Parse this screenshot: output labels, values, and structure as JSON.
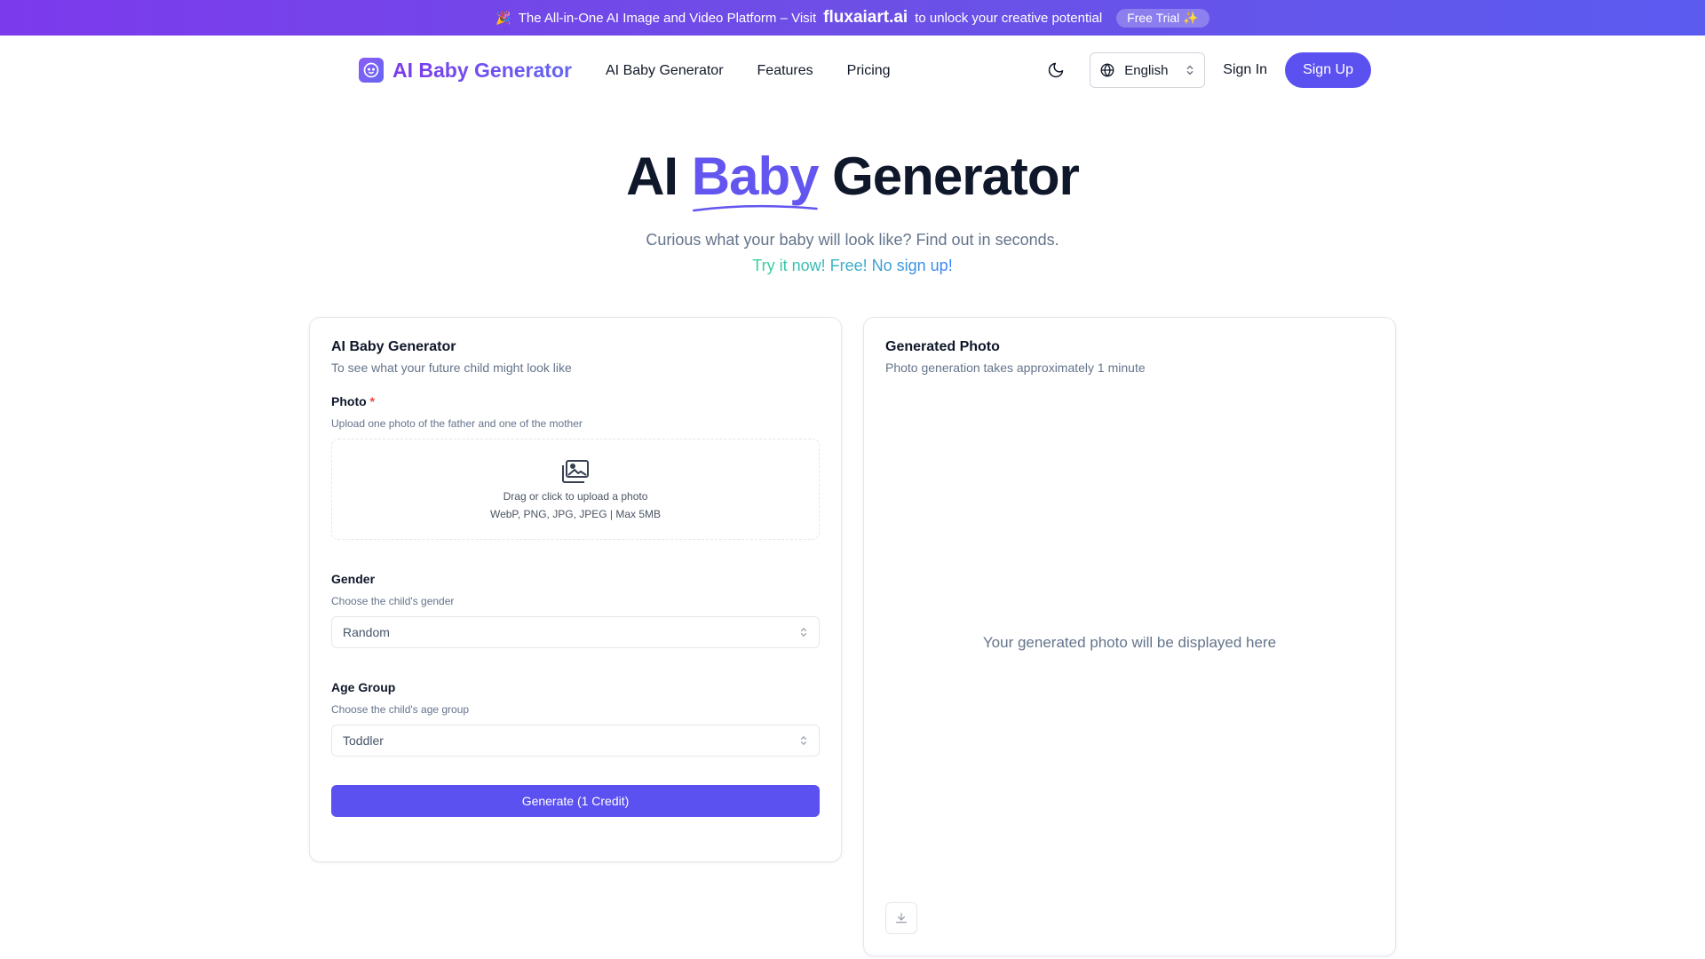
{
  "promo": {
    "text_before": "The All-in-One AI Image and Video Platform – Visit",
    "brand": "fluxaiart.ai",
    "text_after": "to unlock your creative potential",
    "trial_label": "Free Trial"
  },
  "header": {
    "logo_text": "AI Baby Generator",
    "nav": [
      "AI Baby Generator",
      "Features",
      "Pricing"
    ],
    "language": "English",
    "signin_label": "Sign In",
    "signup_label": "Sign Up"
  },
  "hero": {
    "title_prefix": "AI",
    "title_accent": "Baby",
    "title_suffix": "Generator",
    "subtitle": "Curious what your baby will look like? Find out in seconds.",
    "cta": "Try it now! Free! No sign up!"
  },
  "form": {
    "title": "AI Baby Generator",
    "description": "To see what your future child might look like",
    "photo": {
      "label": "Photo",
      "required_mark": "*",
      "description": "Upload one photo of the father and one of the mother",
      "drop_text": "Drag or click to upload a photo",
      "formats": "WebP, PNG, JPG, JPEG | Max 5MB"
    },
    "gender": {
      "label": "Gender",
      "description": "Choose the child's gender",
      "value": "Random"
    },
    "age": {
      "label": "Age Group",
      "description": "Choose the child's age group",
      "value": "Toddler"
    },
    "generate_label": "Generate (1 Credit)"
  },
  "result": {
    "title": "Generated Photo",
    "description": "Photo generation takes approximately 1 minute",
    "placeholder": "Your generated photo will be displayed here"
  },
  "colors": {
    "accent": "#5b50f0",
    "banner_start": "#7c3aed",
    "banner_end": "#5b5bf0"
  }
}
